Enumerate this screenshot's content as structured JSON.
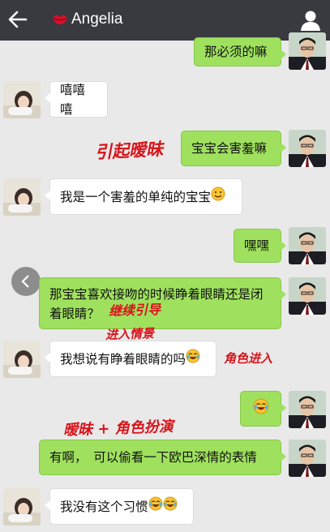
{
  "header": {
    "title": "Angelia",
    "back_icon": "arrow-left-icon",
    "lips_icon": "lips-icon",
    "profile_icon": "person-icon"
  },
  "messages": [
    {
      "side": "right",
      "text": "那必须的嘛"
    },
    {
      "side": "left",
      "text": "嘻嘻嘻"
    },
    {
      "side": "right",
      "text": "宝宝会害羞嘛"
    },
    {
      "side": "left",
      "text": "我是一个害羞的单纯的宝宝",
      "emoji": "smile"
    },
    {
      "side": "right",
      "text": "嘿嘿"
    },
    {
      "side": "right",
      "text": "那宝宝喜欢接吻的时候睁着眼睛还是闭着眼睛？"
    },
    {
      "side": "left",
      "text": "我想说有睁着眼睛的吗",
      "emoji": "joy"
    },
    {
      "side": "right",
      "text": "",
      "emoji": "joy"
    },
    {
      "side": "right",
      "text": "有啊，　可以偷看一下欧巴深情的表情"
    },
    {
      "side": "left",
      "text": "我没有这个习惯",
      "emoji": "joy-joy"
    }
  ],
  "annotations": {
    "a1": "引起暧昧",
    "a2": "继续引导",
    "a3": "进入情景",
    "a4": "角色进入",
    "a5": "暧昧 + 角色扮演"
  },
  "colors": {
    "topbar": "#393a3f",
    "chat_bg": "#e9e9e9",
    "bubble_right": "#9fe15e",
    "bubble_left": "#ffffff",
    "annotation": "#d8141b"
  }
}
